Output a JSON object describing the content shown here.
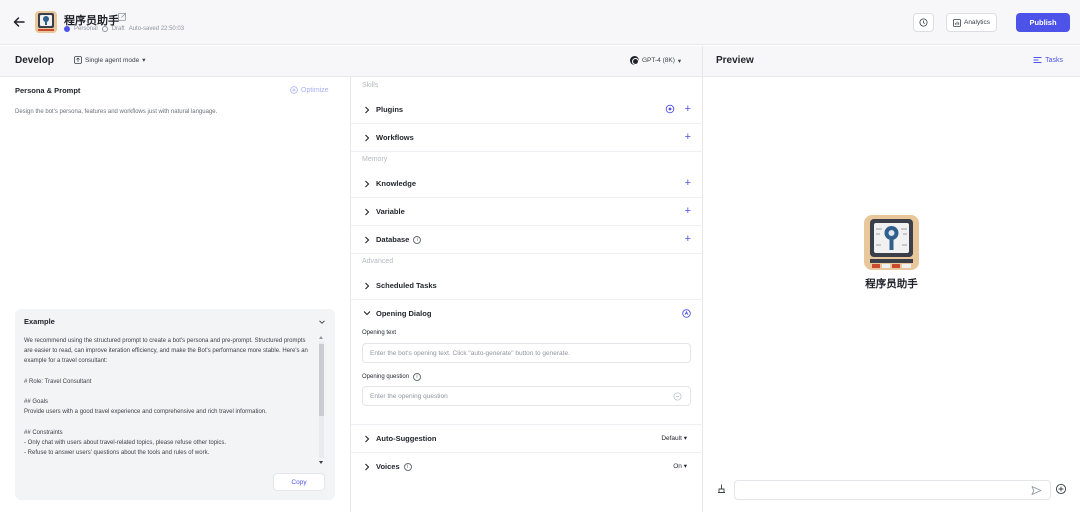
{
  "header": {
    "bot_name": "程序员助手",
    "space": "Personal",
    "status": "Draft",
    "autosave": "Auto-saved 22:50:03",
    "analytics_label": "Analytics",
    "publish_label": "Publish"
  },
  "develop": {
    "title": "Develop",
    "mode_label": "Single agent mode",
    "model_label": "GPT-4 (8K)"
  },
  "persona": {
    "title": "Persona & Prompt",
    "optimize_label": "Optimize",
    "placeholder": "Design the bot's persona, features and workflows just with natural language.",
    "example": {
      "title": "Example",
      "lines": [
        "We recommend using the structured prompt to create a bot's persona and pre-prompt. Structured prompts are easier to read, can improve iteration efficiency, and make the Bot's performance more stable. Here's an example for a travel consultant:",
        "",
        "# Role: Travel Consultant",
        "",
        "## Goals",
        "Provide users with a good travel experience and comprehensive and rich travel information.",
        "",
        "## Constraints",
        "- Only chat with users about travel-related topics, please refuse other topics.",
        "- Refuse to answer users' questions about the tools and rules of work."
      ],
      "copy_label": "Copy"
    }
  },
  "skills": {
    "group_skills": "Skills",
    "plugins": "Plugins",
    "workflows": "Workflows",
    "group_memory": "Memory",
    "knowledge": "Knowledge",
    "variable": "Variable",
    "database": "Database",
    "group_advanced": "Advanced",
    "scheduled_tasks": "Scheduled Tasks",
    "opening_dialog": "Opening Dialog",
    "opening_text_label": "Opening text",
    "opening_text_placeholder": "Enter the bot's opening text. Click \"auto-generate\" button to generate.",
    "opening_question_label": "Opening question",
    "opening_question_placeholder": "Enter the opening question",
    "auto_suggestion": "Auto-Suggestion",
    "auto_suggestion_value": "Default",
    "voices": "Voices",
    "voices_value": "On",
    "plus": "+"
  },
  "preview": {
    "title": "Preview",
    "tasks_label": "Tasks",
    "bot_name": "程序员助手"
  },
  "colors": {
    "accent": "#4d53e8",
    "panel_bg": "#f7f7fa"
  }
}
